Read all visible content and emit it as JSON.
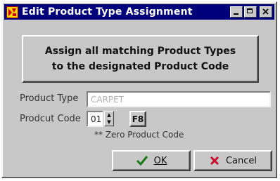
{
  "window": {
    "title": "Edit Product Type Assignment"
  },
  "main": {
    "assign_line1": "Assign all matching Product Types",
    "assign_line2": "to the designated Product Code"
  },
  "form": {
    "product_type_label": "Product Type",
    "product_type_value": "CARPET",
    "product_code_label": "Prodcut Code",
    "product_code_value": "01",
    "lookup_label": "F8",
    "note": "** Zero Product Code"
  },
  "buttons": {
    "ok_label": "OK",
    "cancel_label": "Cancel"
  },
  "colors": {
    "titlebar": "#00007a",
    "ok_check": "#1a7a1a",
    "cancel_x": "#c8102e"
  }
}
